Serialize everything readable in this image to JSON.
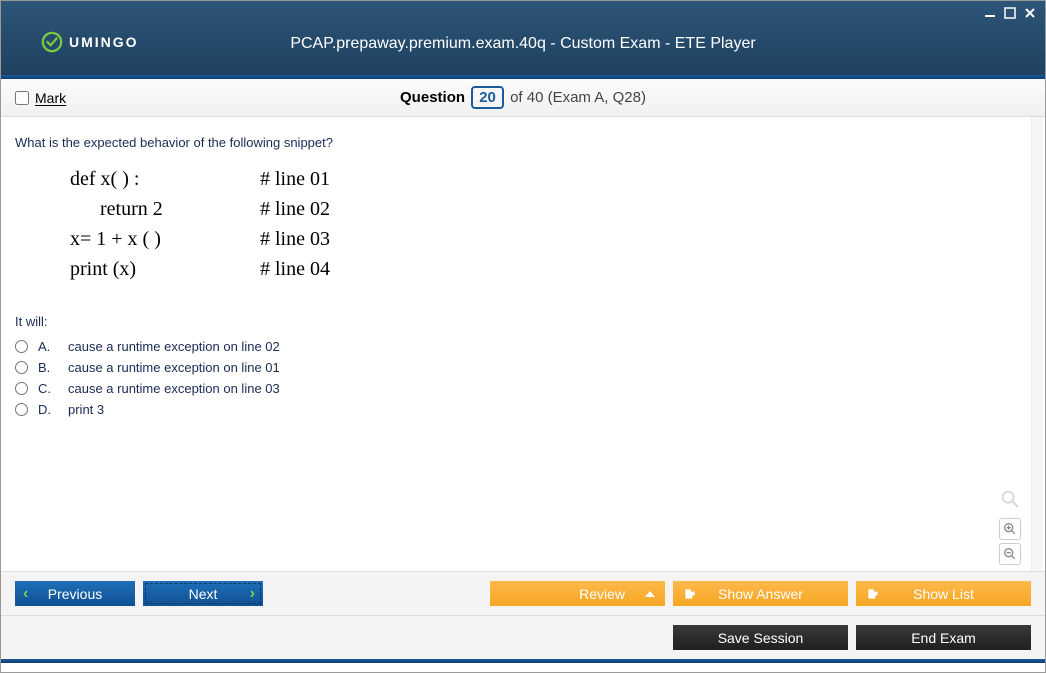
{
  "window": {
    "title": "PCAP.prepaway.premium.exam.40q - Custom Exam - ETE Player",
    "logo": "UMINGO"
  },
  "questionbar": {
    "mark_label": "Mark",
    "question_word": "Question",
    "current": "20",
    "of_total": "of 40 (Exam A, Q28)"
  },
  "content": {
    "prompt": "What is the expected behavior of the following snippet?",
    "code": [
      {
        "c1": "def x( ) :",
        "c2": "# line 01"
      },
      {
        "c1": "      return 2",
        "c2": "# line 02"
      },
      {
        "c1": "",
        "c2": ""
      },
      {
        "c1": "x= 1 + x ( )",
        "c2": "# line 03"
      },
      {
        "c1": "print (x)",
        "c2": "# line 04"
      }
    ],
    "it_will": "It will:",
    "options": [
      {
        "letter": "A.",
        "text": "cause a runtime exception on line 02"
      },
      {
        "letter": "B.",
        "text": "cause a runtime exception on line 01"
      },
      {
        "letter": "C.",
        "text": "cause a runtime exception on line 03"
      },
      {
        "letter": "D.",
        "text": "print 3"
      }
    ]
  },
  "nav": {
    "previous": "Previous",
    "next": "Next",
    "review": "Review",
    "show_answer": "Show Answer",
    "show_list": "Show List"
  },
  "bottom": {
    "save_session": "Save Session",
    "end_exam": "End Exam"
  }
}
